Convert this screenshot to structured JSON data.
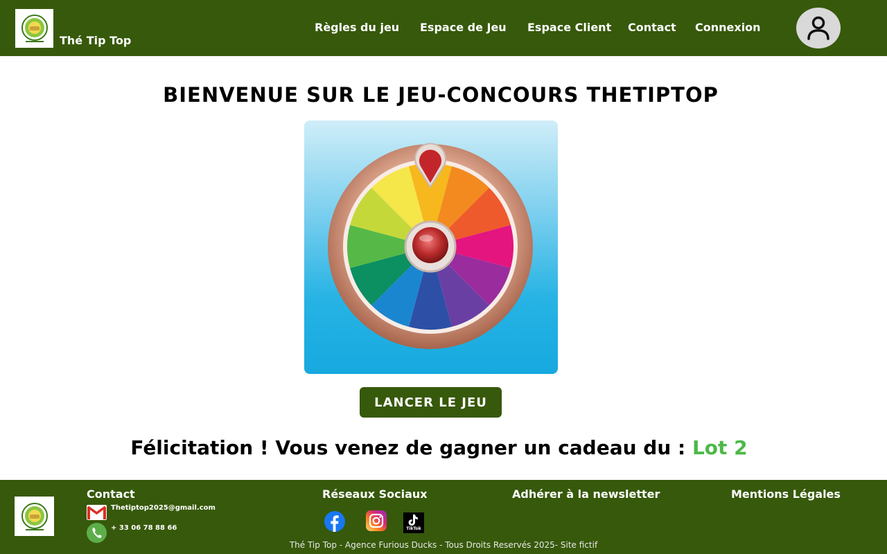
{
  "header": {
    "brand": "Thé Tip Top",
    "nav": {
      "rules": "Règles du jeu",
      "game": "Espace de Jeu",
      "client": "Espace Client",
      "contact": "Contact",
      "login": "Connexion"
    }
  },
  "main": {
    "title": "Bienvenue sur le jeu-concours thetiptop",
    "play_button": "Lancer le jeu",
    "result_prefix": "Félicitation ! Vous venez de gagner un cadeau du : ",
    "result_lot": "Lot 2"
  },
  "footer": {
    "contact_title": "Contact",
    "email": "Thetiptop2025@gmail.com",
    "phone": "+ 33 06 78 88 66",
    "social_title": "Réseaux Sociaux",
    "newsletter": "Adhérer à la newsletter",
    "legal": "Mentions Légales",
    "copyright": "Thé Tip Top - Agence Furious Ducks - Tous Droits Reservés 2025- Site fictif",
    "tiktok_label": "TikTok"
  },
  "colors": {
    "brand_green": "#37590b",
    "lot_green": "#4cb848"
  },
  "icons": [
    "logo",
    "user-icon",
    "wheel-of-fortune",
    "gmail-icon",
    "phone-icon",
    "facebook-icon",
    "instagram-icon",
    "tiktok-icon"
  ]
}
